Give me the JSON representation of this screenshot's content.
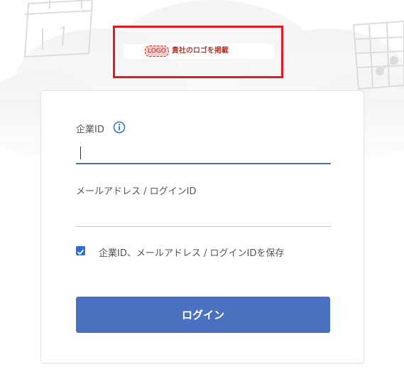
{
  "logo": {
    "badge_text": "LOGO",
    "caption": "貴社のロゴを掲載"
  },
  "form": {
    "company_id_label": "企業ID",
    "company_id_value": "",
    "email_label": "メールアドレス / ログインID",
    "email_value": "",
    "remember_label": "企業ID、メールアドレス / ログインIDを保存",
    "remember_checked": true,
    "login_button": "ログイン"
  },
  "colors": {
    "accent": "#4a70c0",
    "highlight_frame": "#e11b22",
    "checkbox": "#2f6fd6"
  },
  "icons": {
    "info": "info-icon",
    "check": "check-icon"
  }
}
